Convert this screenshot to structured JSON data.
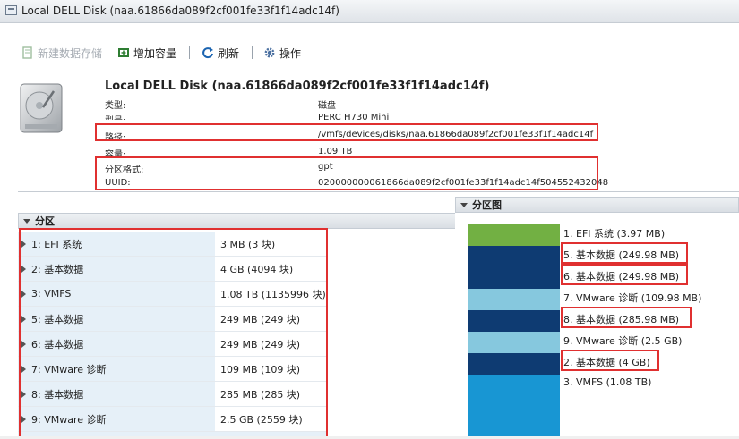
{
  "window": {
    "title": "Local DELL Disk (naa.61866da089f2cf001fe33f1f14adc14f)"
  },
  "toolbar": {
    "new_datastore": "新建数据存储",
    "add_capacity": "增加容量",
    "refresh": "刷新",
    "actions": "操作"
  },
  "disk": {
    "title": "Local DELL Disk (naa.61866da089f2cf001fe33f1f14adc14f)",
    "props": [
      {
        "label": "类型:",
        "value": "磁盘"
      },
      {
        "label": "型号:",
        "value": "PERC H730 Mini"
      },
      {
        "label": "路径:",
        "value": "/vmfs/devices/disks/naa.61866da089f2cf001fe33f1f14adc14f"
      },
      {
        "label": "容量:",
        "value": "1.09 TB"
      },
      {
        "label": "分区格式:",
        "value": "gpt"
      },
      {
        "label": "UUID:",
        "value": "020000000061866da089f2cf001fe33f1f14adc14f504552432048"
      }
    ]
  },
  "partitions": {
    "header": "分区",
    "rows": [
      {
        "name": "1: EFI 系统",
        "size": "3 MB (3 块)"
      },
      {
        "name": "2: 基本数据",
        "size": "4 GB (4094 块)"
      },
      {
        "name": "3: VMFS",
        "size": "1.08 TB (1135996 块)"
      },
      {
        "name": "5: 基本数据",
        "size": "249 MB (249 块)"
      },
      {
        "name": "6: 基本数据",
        "size": "249 MB (249 块)"
      },
      {
        "name": "7: VMware 诊断",
        "size": "109 MB (109 块)"
      },
      {
        "name": "8: 基本数据",
        "size": "285 MB (285 块)"
      },
      {
        "name": "9: VMware 诊断",
        "size": "2.5 GB (2559 块)"
      }
    ]
  },
  "partition_map": {
    "header": "分区图",
    "segments": [
      {
        "label": "1. EFI 系统  (3.97 MB)",
        "color": "#72b043"
      },
      {
        "label": "5. 基本数据  (249.98 MB)",
        "color": "#0e3b72"
      },
      {
        "label": "6. 基本数据  (249.98 MB)",
        "color": "#0e3b72"
      },
      {
        "label": "7. VMware 诊断  (109.98 MB)",
        "color": "#86c8de"
      },
      {
        "label": "8. 基本数据  (285.98 MB)",
        "color": "#0e3b72"
      },
      {
        "label": "9. VMware 诊断  (2.5 GB)",
        "color": "#86c8de"
      },
      {
        "label": "2. 基本数据  (4 GB)",
        "color": "#0e3b72"
      },
      {
        "label": "3. VMFS  (1.08 TB)",
        "color": "#1896d3"
      }
    ]
  },
  "colors": {
    "highlight": "#e03030",
    "accent": "#1a63b0"
  }
}
